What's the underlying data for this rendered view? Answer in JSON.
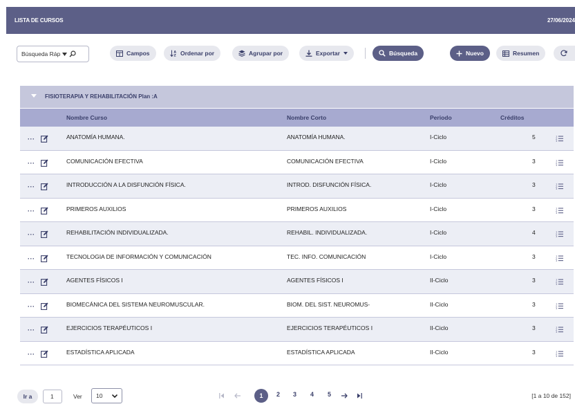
{
  "header": {
    "title": "LISTA DE CURSOS",
    "date": "27/06/2024"
  },
  "toolbar": {
    "search_value": "Búsqueda Ráp",
    "campos": "Campos",
    "ordenar": "Ordenar por",
    "agrupar": "Agrupar por",
    "exportar": "Exportar",
    "busqueda": "Búsqueda",
    "nuevo": "Nuevo",
    "resumen": "Resumen"
  },
  "group": {
    "label": "FISIOTERAPIA Y REHABILITACIÓN Plan :A"
  },
  "columns": {
    "nombre": "Nombre Curso",
    "corto": "Nombre Corto",
    "periodo": "Periodo",
    "creditos": "Créditos"
  },
  "rows": [
    {
      "nombre": "ANATOMÍA HUMANA.",
      "corto": "ANATOMÍA HUMANA.",
      "periodo": "I-Ciclo",
      "creditos": "5"
    },
    {
      "nombre": "COMUNICACIÓN EFECTIVA",
      "corto": "COMUNICACIÓN EFECTIVA",
      "periodo": "I-Ciclo",
      "creditos": "3"
    },
    {
      "nombre": "INTRODUCCIÓN A LA DISFUNCIÓN FÍSICA.",
      "corto": "INTROD. DISFUNCIÓN FÍSICA.",
      "periodo": "I-Ciclo",
      "creditos": "3"
    },
    {
      "nombre": "PRIMEROS AUXILIOS",
      "corto": "PRIMEROS AUXILIOS",
      "periodo": "I-Ciclo",
      "creditos": "3"
    },
    {
      "nombre": "REHABILITACIÓN INDIVIDUALIZADA.",
      "corto": "REHABIL. INDIVIDUALIZADA.",
      "periodo": "I-Ciclo",
      "creditos": "4"
    },
    {
      "nombre": "TECNOLOGIA DE INFORMACIÓN Y COMUNICACIÓN",
      "corto": "TEC. INFO. COMUNICACIÓN",
      "periodo": "I-Ciclo",
      "creditos": "3"
    },
    {
      "nombre": "AGENTES FÍSICOS I",
      "corto": "AGENTES FÍSICOS I",
      "periodo": "II-Ciclo",
      "creditos": "3"
    },
    {
      "nombre": "BIOMECÁNICA DEL SISTEMA NEUROMUSCULAR.",
      "corto": "BIOM. DEL SIST. NEUROMUS-",
      "periodo": "II-Ciclo",
      "creditos": "3"
    },
    {
      "nombre": "EJERCICIOS TERAPÉUTICOS I",
      "corto": "EJERCICIOS TERAPÉUTICOS I",
      "periodo": "II-Ciclo",
      "creditos": "3"
    },
    {
      "nombre": "ESTADÍSTICA APLICADA",
      "corto": "ESTADÍSTICA APLICADA",
      "periodo": "II-Ciclo",
      "creditos": "3"
    }
  ],
  "footer": {
    "ir_a": "Ir a",
    "page_input": "1",
    "ver": "Ver",
    "page_size": "10",
    "pages": [
      "1",
      "2",
      "3",
      "4",
      "5"
    ],
    "current_page": "1",
    "range": "[1 a 10 de 152]"
  },
  "icons": [
    "search-icon",
    "chevron-down-icon",
    "columns-icon",
    "sort-icon",
    "layers-icon",
    "download-icon",
    "plus-icon",
    "table-icon",
    "refresh-icon",
    "more-icon",
    "edit-icon",
    "list-icon",
    "first-page-icon",
    "prev-page-icon",
    "next-page-icon",
    "last-page-icon"
  ],
  "colors": {
    "primary": "#5c5f87",
    "header_row": "#a7aad0",
    "group_row": "#c5c7dc",
    "alt_row": "#eceef5"
  }
}
